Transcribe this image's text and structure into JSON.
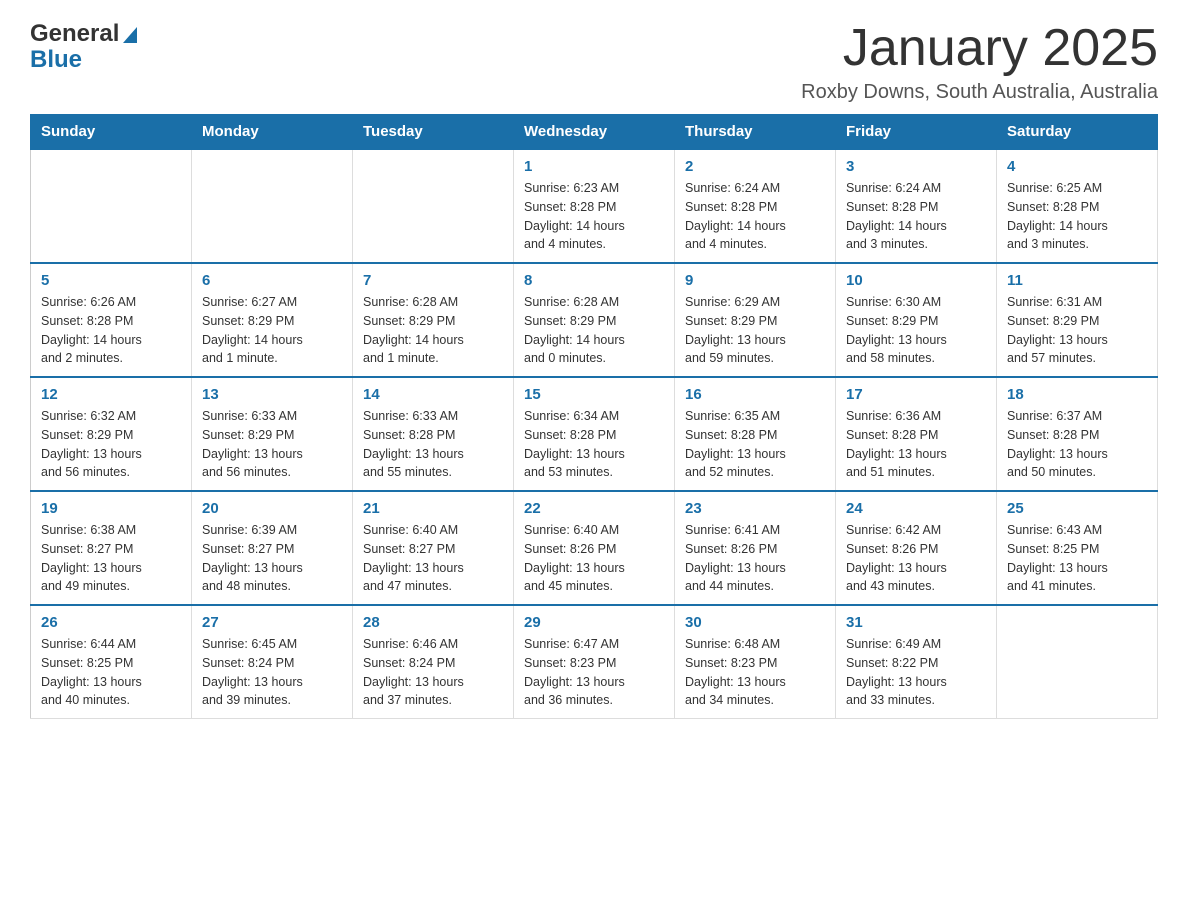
{
  "header": {
    "logo_general": "General",
    "logo_blue": "Blue",
    "title": "January 2025",
    "subtitle": "Roxby Downs, South Australia, Australia"
  },
  "calendar": {
    "days_of_week": [
      "Sunday",
      "Monday",
      "Tuesday",
      "Wednesday",
      "Thursday",
      "Friday",
      "Saturday"
    ],
    "weeks": [
      [
        {
          "day": "",
          "info": ""
        },
        {
          "day": "",
          "info": ""
        },
        {
          "day": "",
          "info": ""
        },
        {
          "day": "1",
          "info": "Sunrise: 6:23 AM\nSunset: 8:28 PM\nDaylight: 14 hours\nand 4 minutes."
        },
        {
          "day": "2",
          "info": "Sunrise: 6:24 AM\nSunset: 8:28 PM\nDaylight: 14 hours\nand 4 minutes."
        },
        {
          "day": "3",
          "info": "Sunrise: 6:24 AM\nSunset: 8:28 PM\nDaylight: 14 hours\nand 3 minutes."
        },
        {
          "day": "4",
          "info": "Sunrise: 6:25 AM\nSunset: 8:28 PM\nDaylight: 14 hours\nand 3 minutes."
        }
      ],
      [
        {
          "day": "5",
          "info": "Sunrise: 6:26 AM\nSunset: 8:28 PM\nDaylight: 14 hours\nand 2 minutes."
        },
        {
          "day": "6",
          "info": "Sunrise: 6:27 AM\nSunset: 8:29 PM\nDaylight: 14 hours\nand 1 minute."
        },
        {
          "day": "7",
          "info": "Sunrise: 6:28 AM\nSunset: 8:29 PM\nDaylight: 14 hours\nand 1 minute."
        },
        {
          "day": "8",
          "info": "Sunrise: 6:28 AM\nSunset: 8:29 PM\nDaylight: 14 hours\nand 0 minutes."
        },
        {
          "day": "9",
          "info": "Sunrise: 6:29 AM\nSunset: 8:29 PM\nDaylight: 13 hours\nand 59 minutes."
        },
        {
          "day": "10",
          "info": "Sunrise: 6:30 AM\nSunset: 8:29 PM\nDaylight: 13 hours\nand 58 minutes."
        },
        {
          "day": "11",
          "info": "Sunrise: 6:31 AM\nSunset: 8:29 PM\nDaylight: 13 hours\nand 57 minutes."
        }
      ],
      [
        {
          "day": "12",
          "info": "Sunrise: 6:32 AM\nSunset: 8:29 PM\nDaylight: 13 hours\nand 56 minutes."
        },
        {
          "day": "13",
          "info": "Sunrise: 6:33 AM\nSunset: 8:29 PM\nDaylight: 13 hours\nand 56 minutes."
        },
        {
          "day": "14",
          "info": "Sunrise: 6:33 AM\nSunset: 8:28 PM\nDaylight: 13 hours\nand 55 minutes."
        },
        {
          "day": "15",
          "info": "Sunrise: 6:34 AM\nSunset: 8:28 PM\nDaylight: 13 hours\nand 53 minutes."
        },
        {
          "day": "16",
          "info": "Sunrise: 6:35 AM\nSunset: 8:28 PM\nDaylight: 13 hours\nand 52 minutes."
        },
        {
          "day": "17",
          "info": "Sunrise: 6:36 AM\nSunset: 8:28 PM\nDaylight: 13 hours\nand 51 minutes."
        },
        {
          "day": "18",
          "info": "Sunrise: 6:37 AM\nSunset: 8:28 PM\nDaylight: 13 hours\nand 50 minutes."
        }
      ],
      [
        {
          "day": "19",
          "info": "Sunrise: 6:38 AM\nSunset: 8:27 PM\nDaylight: 13 hours\nand 49 minutes."
        },
        {
          "day": "20",
          "info": "Sunrise: 6:39 AM\nSunset: 8:27 PM\nDaylight: 13 hours\nand 48 minutes."
        },
        {
          "day": "21",
          "info": "Sunrise: 6:40 AM\nSunset: 8:27 PM\nDaylight: 13 hours\nand 47 minutes."
        },
        {
          "day": "22",
          "info": "Sunrise: 6:40 AM\nSunset: 8:26 PM\nDaylight: 13 hours\nand 45 minutes."
        },
        {
          "day": "23",
          "info": "Sunrise: 6:41 AM\nSunset: 8:26 PM\nDaylight: 13 hours\nand 44 minutes."
        },
        {
          "day": "24",
          "info": "Sunrise: 6:42 AM\nSunset: 8:26 PM\nDaylight: 13 hours\nand 43 minutes."
        },
        {
          "day": "25",
          "info": "Sunrise: 6:43 AM\nSunset: 8:25 PM\nDaylight: 13 hours\nand 41 minutes."
        }
      ],
      [
        {
          "day": "26",
          "info": "Sunrise: 6:44 AM\nSunset: 8:25 PM\nDaylight: 13 hours\nand 40 minutes."
        },
        {
          "day": "27",
          "info": "Sunrise: 6:45 AM\nSunset: 8:24 PM\nDaylight: 13 hours\nand 39 minutes."
        },
        {
          "day": "28",
          "info": "Sunrise: 6:46 AM\nSunset: 8:24 PM\nDaylight: 13 hours\nand 37 minutes."
        },
        {
          "day": "29",
          "info": "Sunrise: 6:47 AM\nSunset: 8:23 PM\nDaylight: 13 hours\nand 36 minutes."
        },
        {
          "day": "30",
          "info": "Sunrise: 6:48 AM\nSunset: 8:23 PM\nDaylight: 13 hours\nand 34 minutes."
        },
        {
          "day": "31",
          "info": "Sunrise: 6:49 AM\nSunset: 8:22 PM\nDaylight: 13 hours\nand 33 minutes."
        },
        {
          "day": "",
          "info": ""
        }
      ]
    ]
  }
}
